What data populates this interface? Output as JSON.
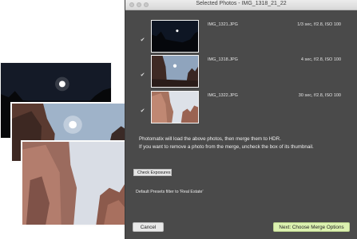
{
  "window": {
    "title": "Selected Photos - IMG_1318_21_22"
  },
  "photos": [
    {
      "file": "IMG_1321.JPG",
      "exposure": "1/3 sec, f/2.8, ISO 100",
      "checked": true
    },
    {
      "file": "IMG_1318.JPG",
      "exposure": "4 sec, f/2.8, ISO 100",
      "checked": true
    },
    {
      "file": "IMG_1322.JPG",
      "exposure": "30 sec, f/2.8, ISO 100",
      "checked": true
    }
  ],
  "info": {
    "line1": "Photomatix will load the above photos, then merge them to HDR.",
    "line2": "If you want to remove a photo from the merge, uncheck the box of its thumbnail."
  },
  "buttons": {
    "cancel": "Cancel",
    "next": "Next: Choose Merge Options",
    "check_exposures": "Check Exposures"
  },
  "preset_note": "Default Presets filter to 'Real Estate'",
  "colors": {
    "dialog_bg": "#4a4a4a",
    "next_button": "#dcf2b0"
  }
}
